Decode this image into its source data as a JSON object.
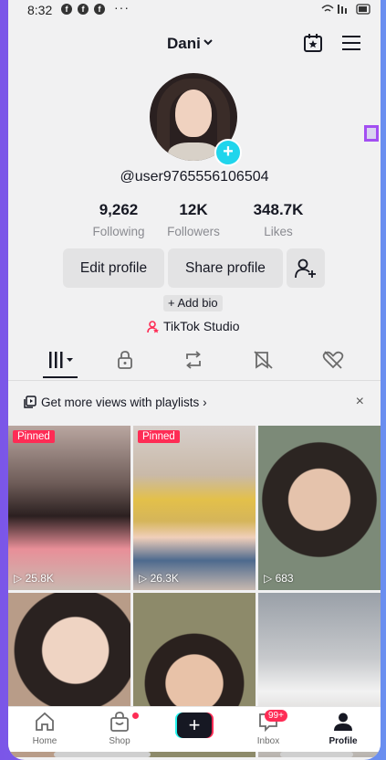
{
  "status": {
    "time": "8:32",
    "notif_icons": [
      "facebook-icon",
      "facebook-icon",
      "facebook-icon"
    ],
    "more": "···"
  },
  "header": {
    "title": "Dani"
  },
  "profile": {
    "handle": "@user9765556106504"
  },
  "stats": [
    {
      "value": "9,262",
      "label": "Following"
    },
    {
      "value": "12K",
      "label": "Followers"
    },
    {
      "value": "348.7K",
      "label": "Likes"
    }
  ],
  "buttons": {
    "edit": "Edit profile",
    "share": "Share profile"
  },
  "bio": {
    "add": "+ Add bio"
  },
  "studio": {
    "label": "TikTok Studio"
  },
  "banner": {
    "text": "Get more views with playlists",
    "close": "×"
  },
  "videos": [
    {
      "pinned": "Pinned",
      "views": "25.8K"
    },
    {
      "pinned": "Pinned",
      "views": "26.3K"
    },
    {
      "pinned": "",
      "views": "683"
    },
    {
      "pinned": "",
      "views": ""
    },
    {
      "pinned": "",
      "views": ""
    },
    {
      "pinned": "",
      "views": ""
    }
  ],
  "nav": {
    "home": "Home",
    "shop": "Shop",
    "create": "+",
    "inbox": "Inbox",
    "inbox_badge": "99+",
    "profile": "Profile"
  },
  "colors": {
    "accent": "#fe2c55",
    "cyan": "#20d5ec",
    "text": "#161823"
  }
}
